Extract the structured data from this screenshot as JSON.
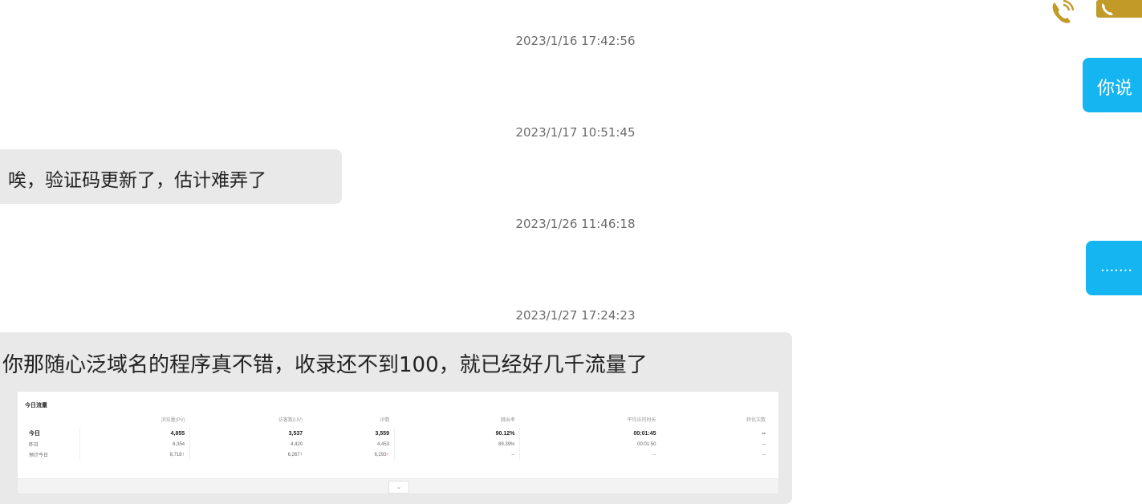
{
  "header": {
    "call_icon": "phone-icon",
    "video_icon": "handset-icon",
    "icon_color": "#c19a28"
  },
  "messages": [
    {
      "timestamp": "2023/1/16 17:42:56"
    },
    {
      "timestamp": "2023/1/17 10:51:45",
      "incoming_text": "唉，验证码更新了，估计难弄了"
    },
    {
      "timestamp": "2023/1/26 11:46:18"
    },
    {
      "timestamp": "2023/1/27 17:24:23",
      "incoming_text": "你那随心泛域名的程序真不错，收录还不到100，就已经好几千流量了"
    }
  ],
  "outgoing": [
    {
      "text": "你说"
    },
    {
      "text": "......."
    }
  ],
  "stats_image": {
    "title": "今日流量",
    "columns": [
      "",
      "浏览量(PV)",
      "访客数(UV)",
      "IP数",
      "跳出率",
      "平均访问时长",
      "转化次数"
    ],
    "rows": [
      {
        "label": "今日",
        "values": [
          "4,855",
          "3,537",
          "3,559",
          "90.12%",
          "00:01:45",
          "--"
        ]
      },
      {
        "label": "昨日",
        "values": [
          "6,354",
          "4,420",
          "4,453",
          "89.39%",
          "00:01:50",
          "--"
        ]
      },
      {
        "label": "预计今日",
        "values": [
          "8,718",
          "6,267",
          "6,293",
          "--",
          "--",
          "--"
        ]
      }
    ],
    "up_arrow": "↑"
  }
}
